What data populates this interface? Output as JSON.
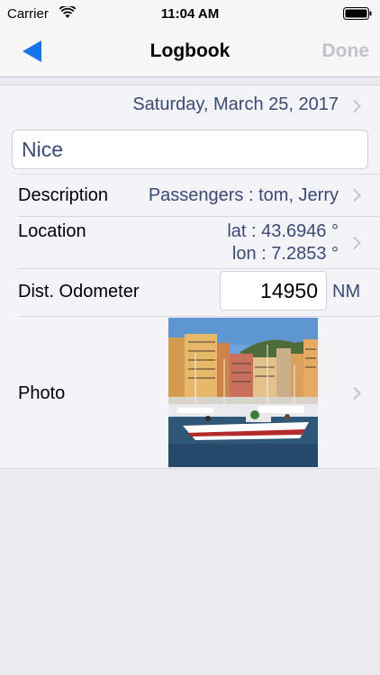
{
  "status_bar": {
    "carrier": "Carrier",
    "time": "11:04 AM",
    "wifi_icon": "wifi-icon",
    "battery_icon": "battery-full-icon"
  },
  "nav": {
    "title": "Logbook",
    "done_label": "Done",
    "back_icon": "back-arrow-icon",
    "accent_color": "#1a73e8"
  },
  "entry": {
    "date": "Saturday, March 25, 2017",
    "name": "Nice",
    "description_label": "Description",
    "description_value": "Passengers : tom, Jerry",
    "location_label": "Location",
    "lat": "lat : 43.6946 °",
    "lon": "lon : 7.2853 °",
    "odometer_label": "Dist. Odometer",
    "odometer_value": "14950",
    "odometer_unit": "NM",
    "photo_label": "Photo"
  },
  "colors": {
    "value_text": "#3b4a74",
    "disabled_text": "#c2c2c7"
  }
}
